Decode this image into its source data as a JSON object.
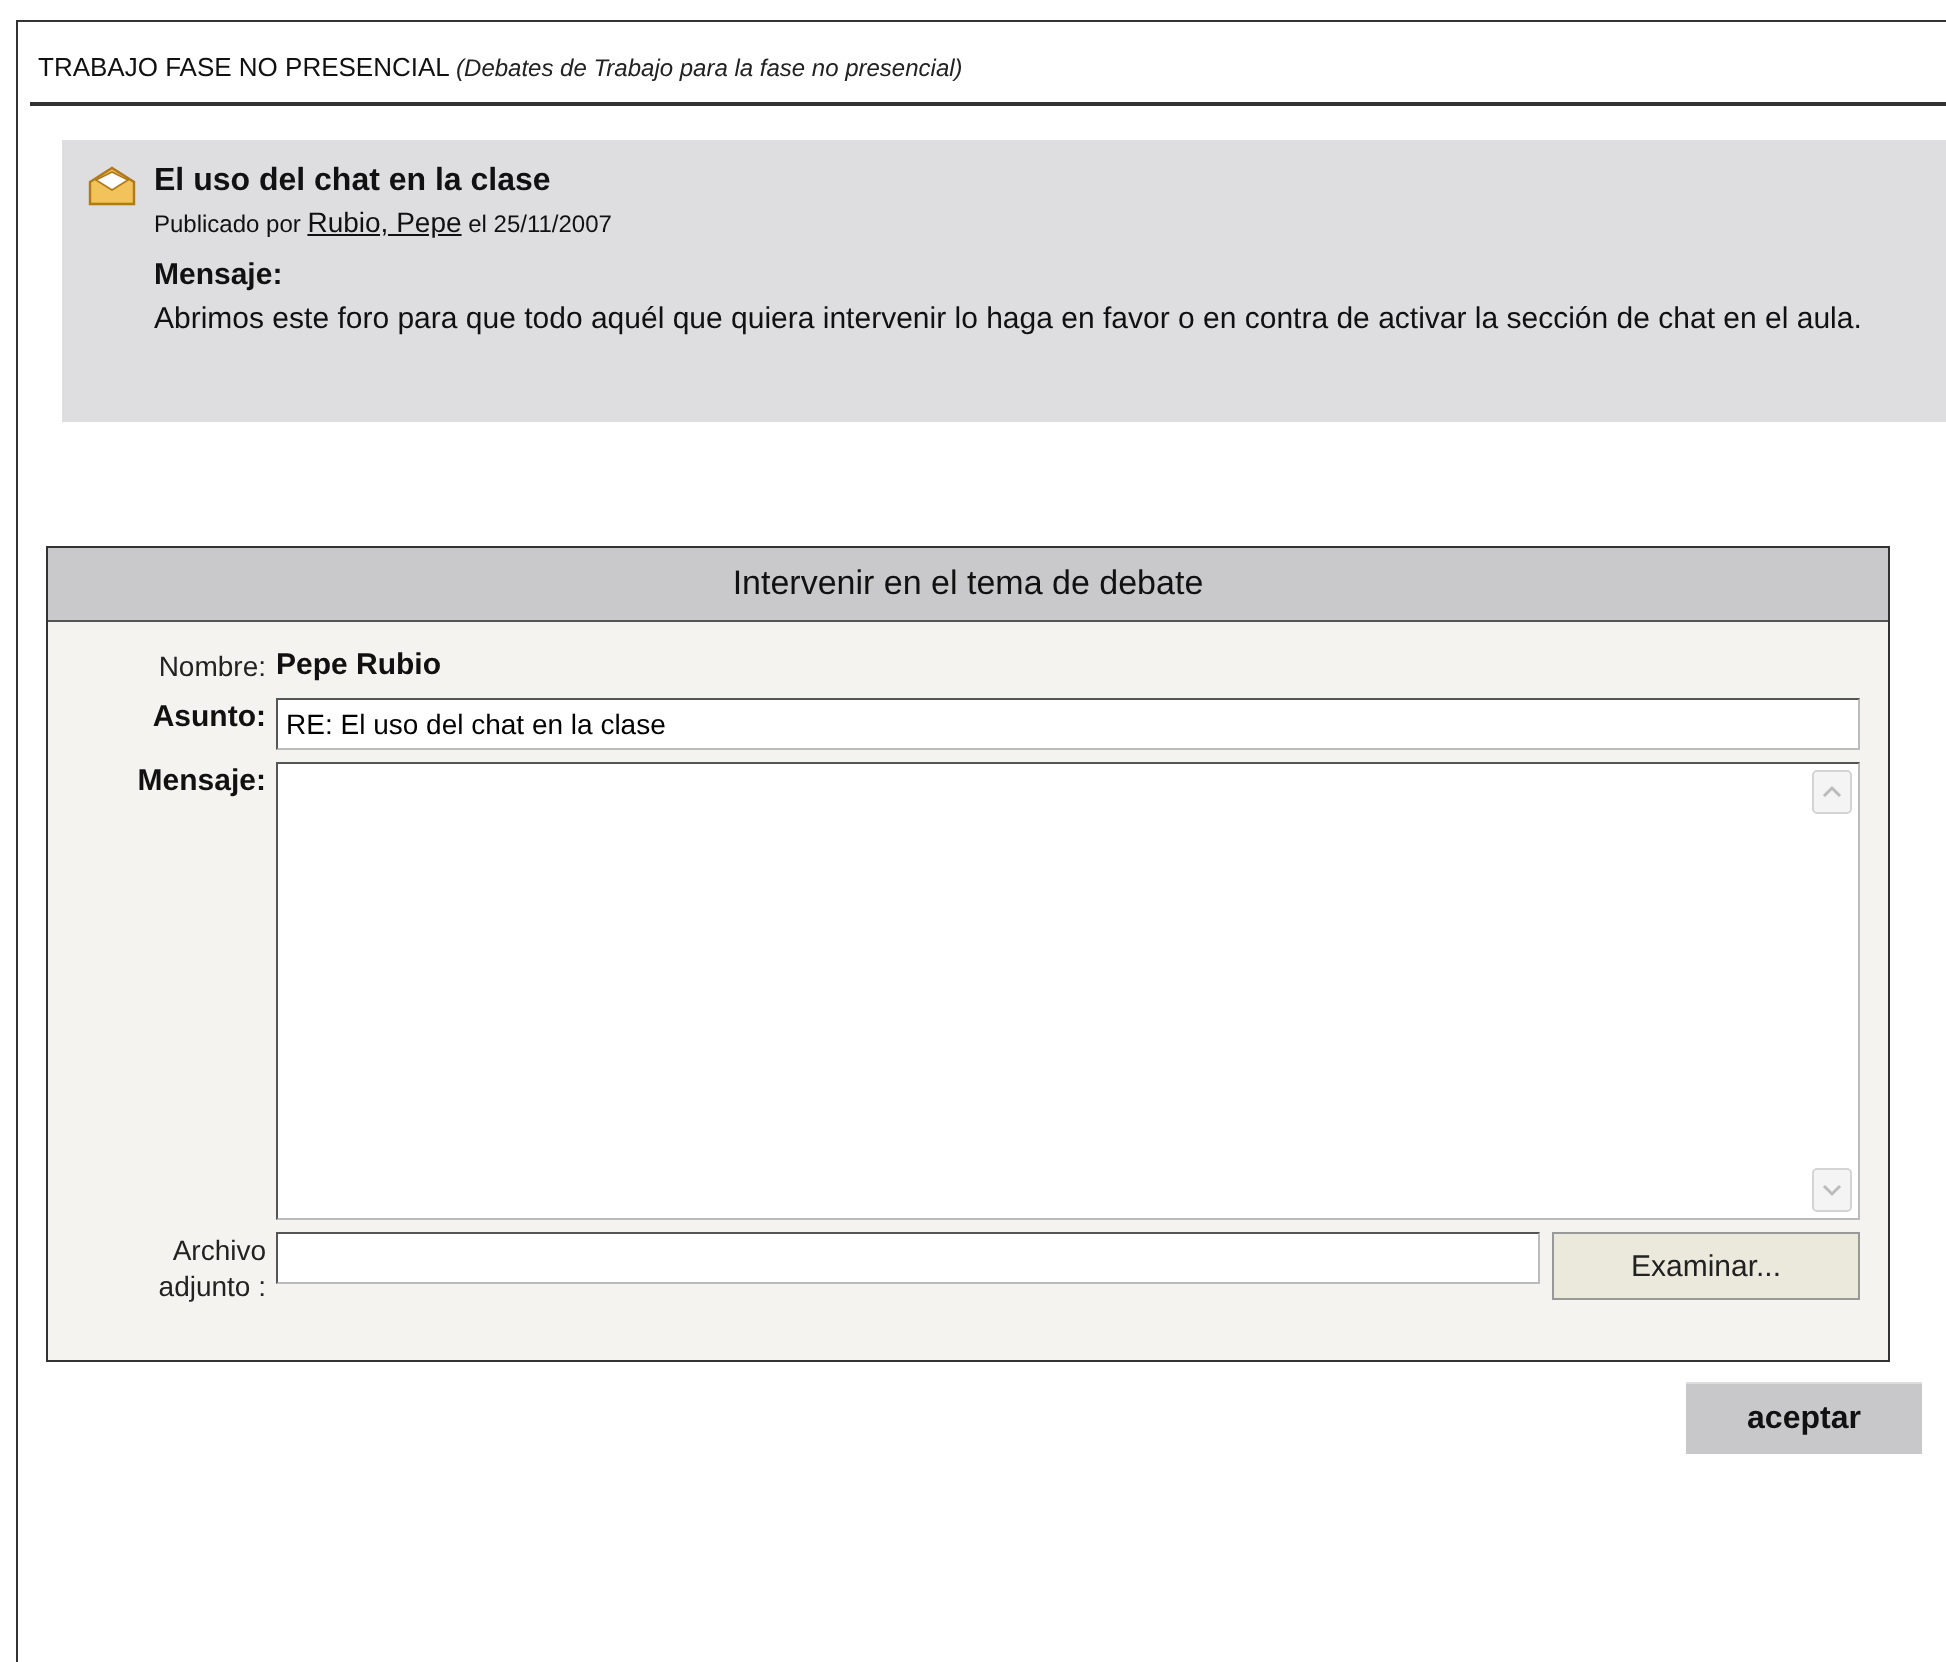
{
  "section": {
    "title": "TRABAJO FASE NO PRESENCIAL",
    "subtitle": "(Debates de Trabajo para la fase no presencial)"
  },
  "post": {
    "title": "El uso del chat en la clase",
    "byline_prefix": "Publicado por",
    "author": "Rubio, Pepe",
    "byline_suffix": "el 25/11/2007",
    "message_label": "Mensaje:",
    "message": "Abrimos este foro para que todo aquél que quiera intervenir lo haga en favor o en contra de activar la sección de chat en el aula."
  },
  "form": {
    "title": "Intervenir en el tema de debate",
    "name_label": "Nombre:",
    "name_value": "Pepe Rubio",
    "subject_label": "Asunto:",
    "subject_value": "RE: El uso del chat en la clase",
    "message_label": "Mensaje:",
    "attachment_label": "Archivo adjunto :",
    "browse_button": "Examinar..."
  },
  "submit_button": "aceptar"
}
